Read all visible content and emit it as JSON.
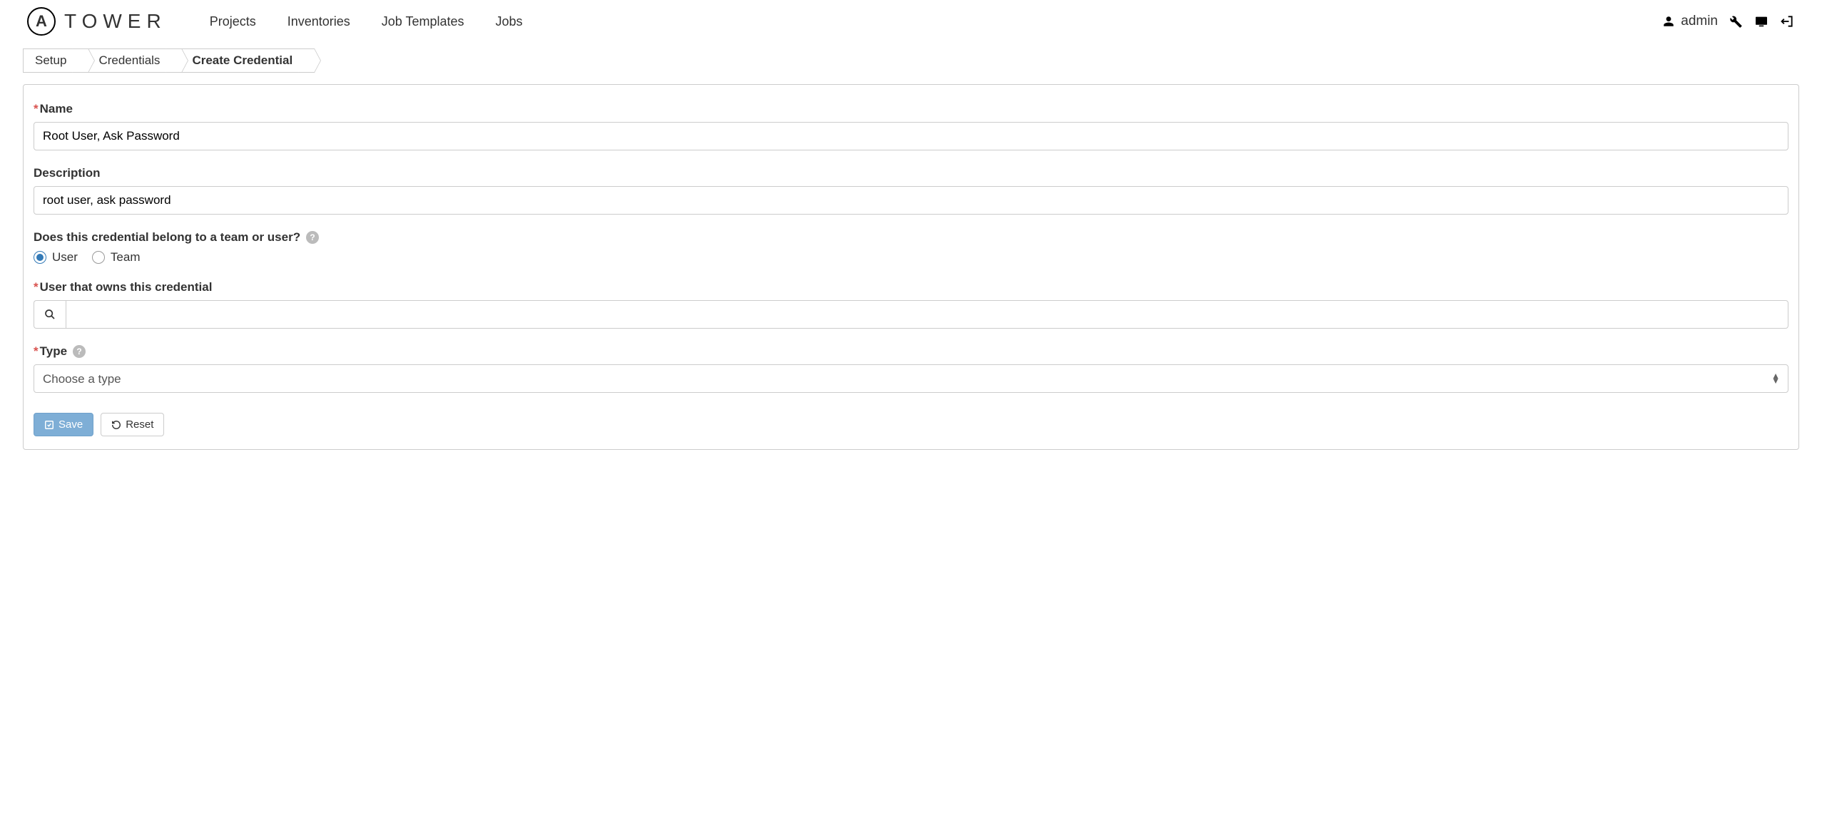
{
  "header": {
    "logo_text": "TOWER",
    "nav": {
      "projects": "Projects",
      "inventories": "Inventories",
      "job_templates": "Job Templates",
      "jobs": "Jobs"
    },
    "user": "admin"
  },
  "breadcrumb": {
    "setup": "Setup",
    "credentials": "Credentials",
    "create": "Create Credential"
  },
  "form": {
    "name_label": "Name",
    "name_value": "Root User, Ask Password",
    "description_label": "Description",
    "description_value": "root user, ask password",
    "owner_question": "Does this credential belong to a team or user?",
    "owner_user": "User",
    "owner_team": "Team",
    "owner_selected": "user",
    "user_label": "User that owns this credential",
    "user_value": "",
    "type_label": "Type",
    "type_placeholder": "Choose a type"
  },
  "buttons": {
    "save": "Save",
    "reset": "Reset"
  }
}
